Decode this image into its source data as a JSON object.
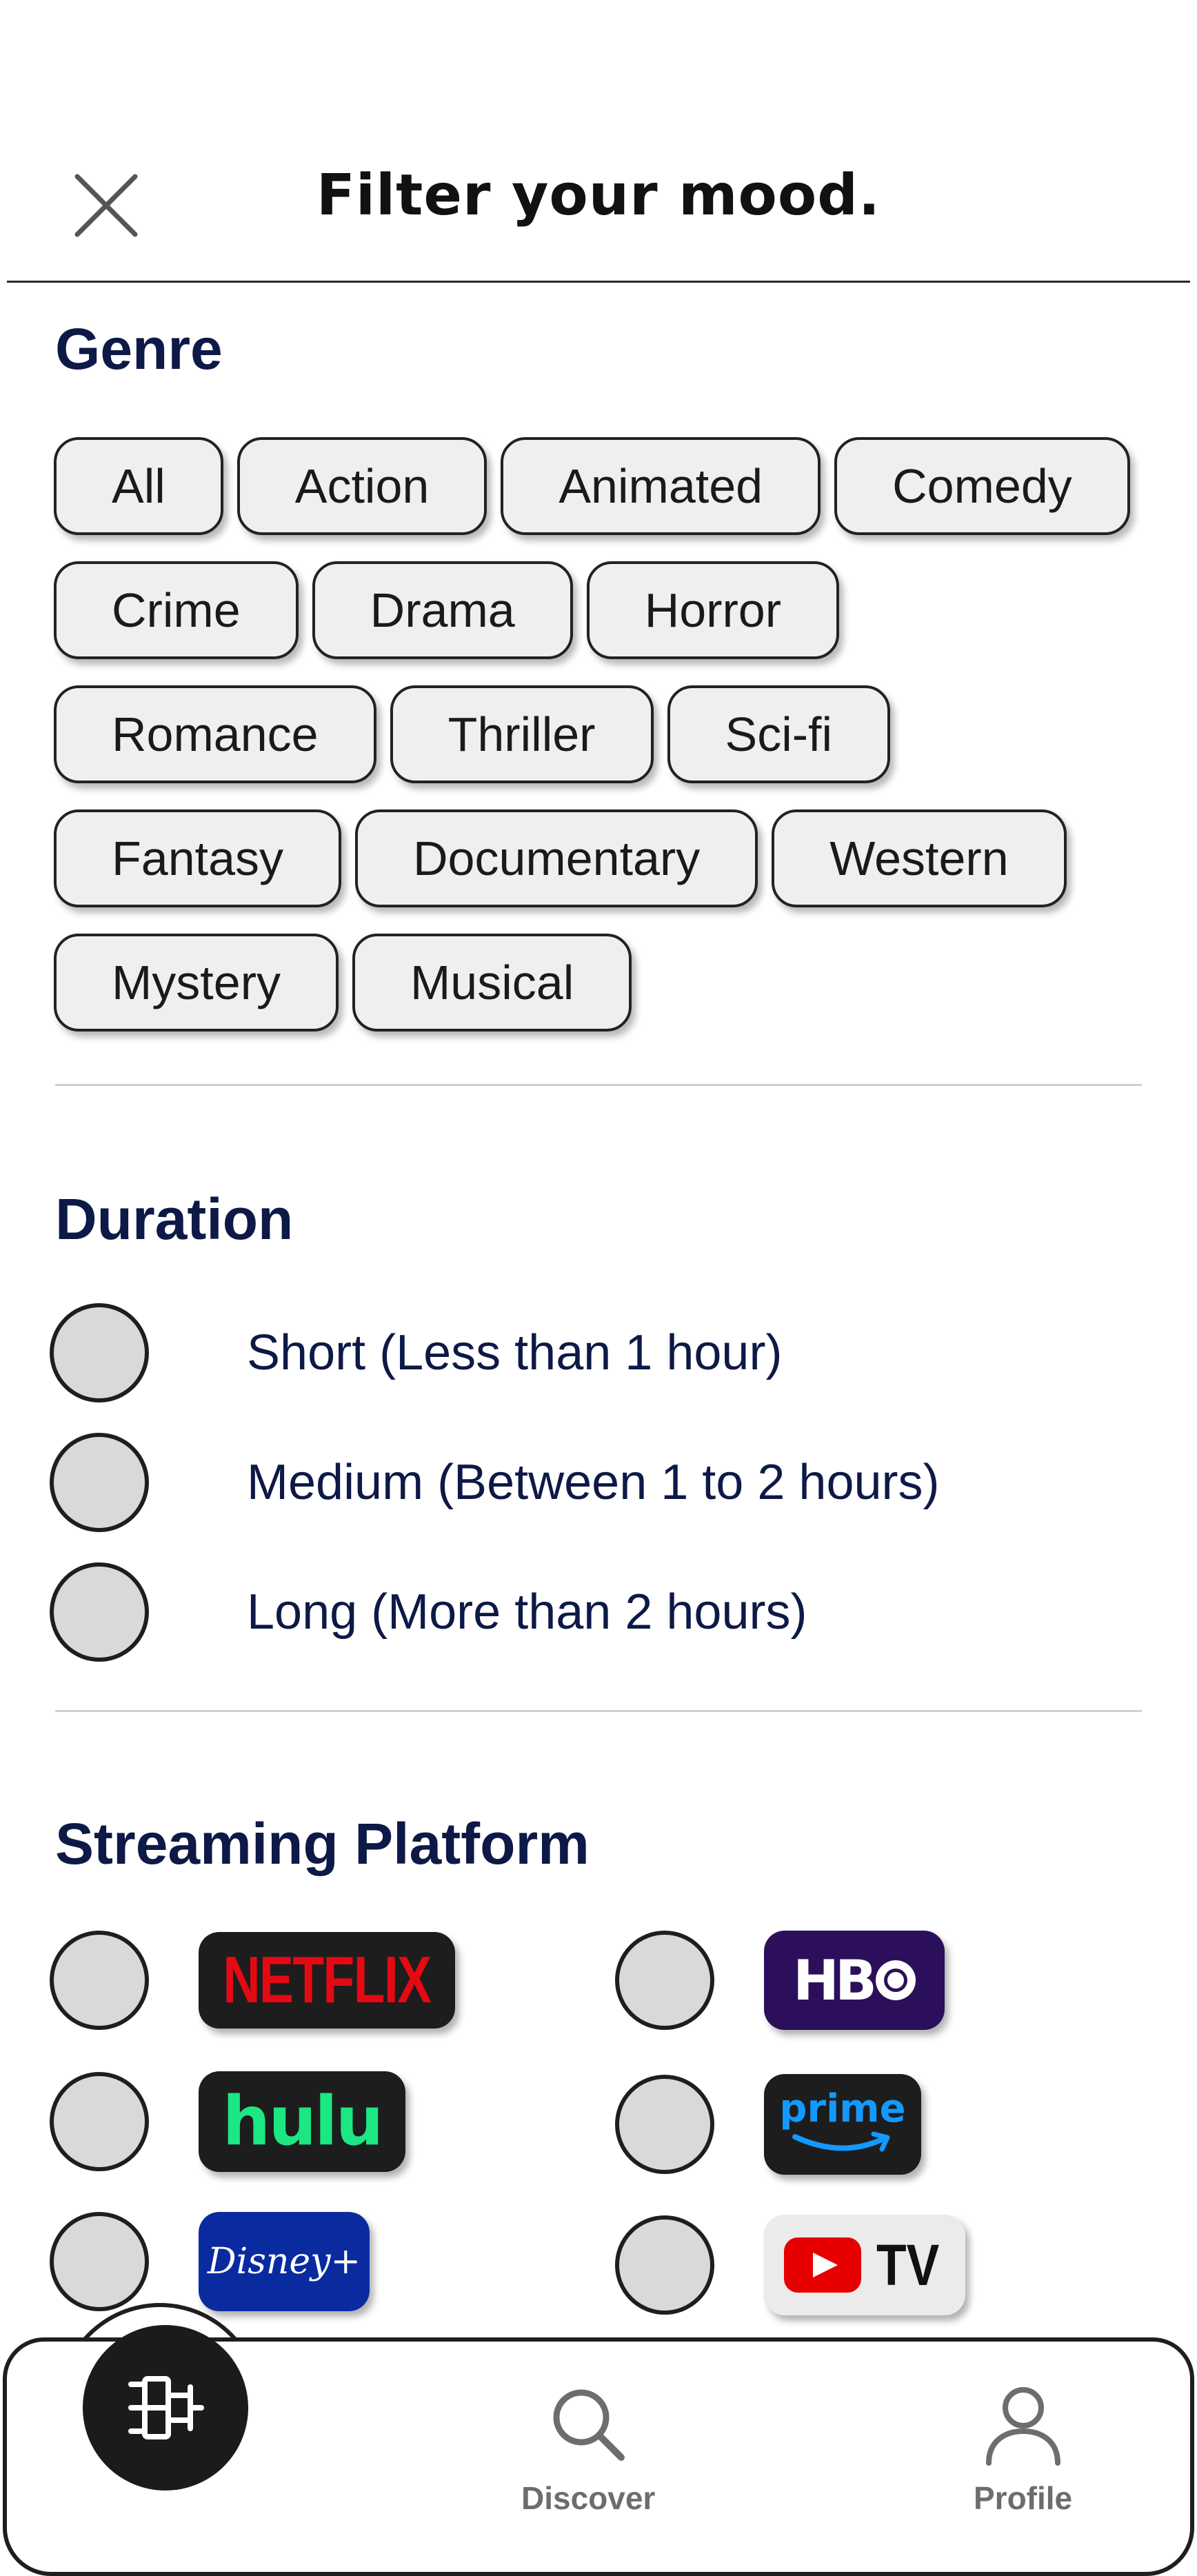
{
  "header": {
    "title": "Filter your mood."
  },
  "genre": {
    "title": "Genre",
    "rows": [
      [
        "All",
        "Action",
        "Animated",
        "Comedy"
      ],
      [
        "Crime",
        "Drama",
        "Horror"
      ],
      [
        "Romance",
        "Thriller",
        "Sci-fi"
      ],
      [
        "Fantasy",
        "Documentary",
        "Western"
      ],
      [
        "Mystery",
        "Musical"
      ]
    ]
  },
  "duration": {
    "title": "Duration",
    "options": [
      "Short (Less than 1 hour)",
      "Medium (Between 1 to 2 hours)",
      "Long (More than 2 hours)"
    ]
  },
  "platform": {
    "title": "Streaming Platform",
    "netflix": "NETFLIX",
    "hbo": "HB",
    "hulu": "hulu",
    "prime": "prime",
    "disney": "Disney+",
    "youtube_tv": "TV"
  },
  "nav": {
    "discover": "Discover",
    "profile": "Profile"
  },
  "colors": {
    "heading": "#0d1946",
    "chip_bg": "#efefef",
    "radio_bg": "#d9d9d9",
    "netflix_red": "#e50914",
    "hulu_green": "#1ce783",
    "hbo_purple": "#2c0f5a",
    "prime_blue": "#1399ff",
    "disney_blue": "#0a2ba0",
    "youtube_red": "#e60000"
  }
}
